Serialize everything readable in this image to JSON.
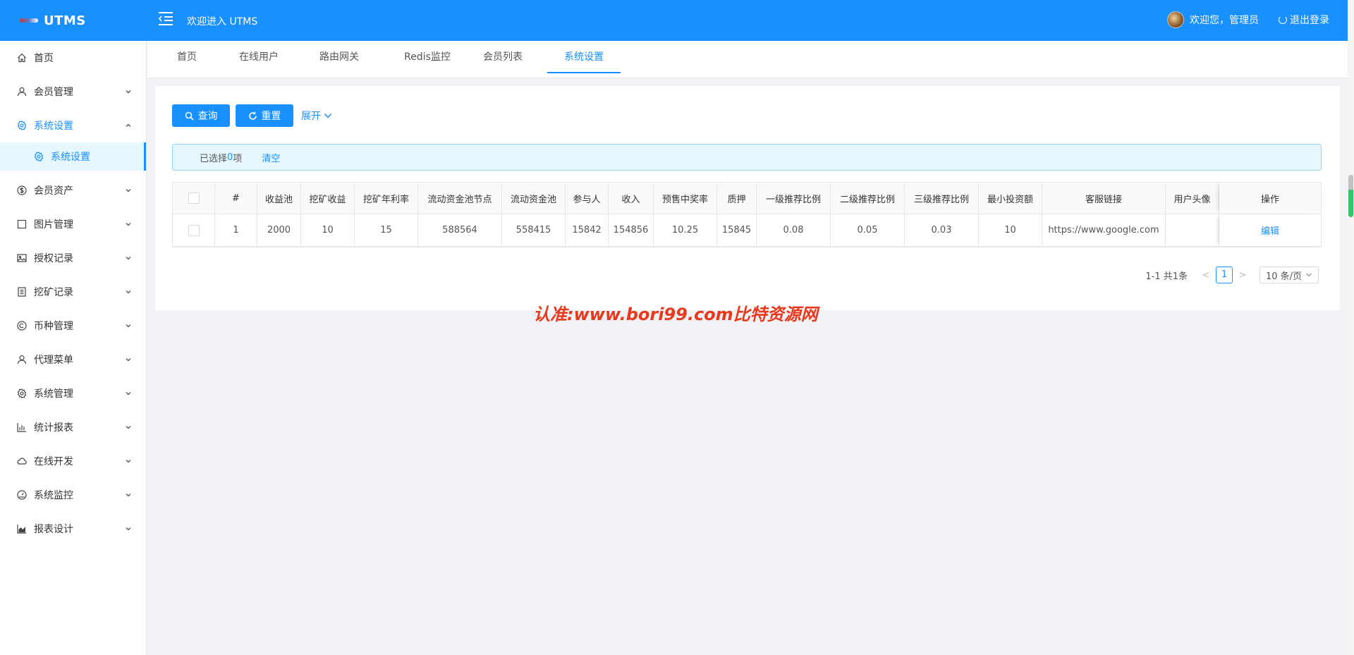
{
  "header": {
    "app_name": "UTMS",
    "welcome_title": "欢迎进入 UTMS",
    "user_greeting": "欢迎您，管理员",
    "logout_label": "退出登录",
    "brand_color": "#1890ff"
  },
  "sidebar": {
    "items": [
      {
        "label": "首页",
        "icon": "home-icon"
      },
      {
        "label": "会员管理",
        "icon": "user-icon"
      },
      {
        "label": "系统设置",
        "icon": "gear-icon",
        "open": true
      },
      {
        "label": "系统设置",
        "icon": "gear-icon",
        "sub": true,
        "active": true
      },
      {
        "label": "会员资产",
        "icon": "dollar-icon"
      },
      {
        "label": "图片管理",
        "icon": "square-icon"
      },
      {
        "label": "授权记录",
        "icon": "picture-icon"
      },
      {
        "label": "挖矿记录",
        "icon": "list-icon"
      },
      {
        "label": "币种管理",
        "icon": "copyright-icon"
      },
      {
        "label": "代理菜单",
        "icon": "user-icon"
      },
      {
        "label": "系统管理",
        "icon": "gear-icon"
      },
      {
        "label": "统计报表",
        "icon": "bar-chart-icon"
      },
      {
        "label": "在线开发",
        "icon": "cloud-icon"
      },
      {
        "label": "系统监控",
        "icon": "dashboard-icon"
      },
      {
        "label": "报表设计",
        "icon": "area-chart-icon"
      }
    ]
  },
  "tabs": [
    {
      "label": "首页"
    },
    {
      "label": "在线用户"
    },
    {
      "label": "路由网关"
    },
    {
      "label": "Redis监控"
    },
    {
      "label": "会员列表"
    },
    {
      "label": "系统设置",
      "active": true
    }
  ],
  "toolbar": {
    "query_label": "查询",
    "reset_label": "重置",
    "expand_label": "展开"
  },
  "selection": {
    "prefix": "已选择",
    "count": "0",
    "suffix": "项",
    "clear_label": "清空"
  },
  "table": {
    "columns": [
      "#",
      "收益池",
      "挖矿收益",
      "挖矿年利率",
      "流动资金池节点",
      "流动资金池",
      "参与人",
      "收入",
      "预售中奖率",
      "质押",
      "一级推荐比例",
      "二级推荐比例",
      "三级推荐比例",
      "最小投资额",
      "客服链接",
      "用户头像",
      "操作"
    ],
    "rows": [
      {
        "cells": [
          "1",
          "2000",
          "10",
          "15",
          "588564",
          "558415",
          "15842",
          "154856",
          "10.25",
          "15845",
          "0.08",
          "0.05",
          "0.03",
          "10",
          "https://www.google.com",
          ""
        ],
        "action": "编辑"
      }
    ]
  },
  "pagination": {
    "summary": "1-1 共1条",
    "current_page": "1",
    "page_size": "10 条/页",
    "prev": "<",
    "next": ">"
  },
  "watermark": "认准:www.bori99.com比特资源网"
}
